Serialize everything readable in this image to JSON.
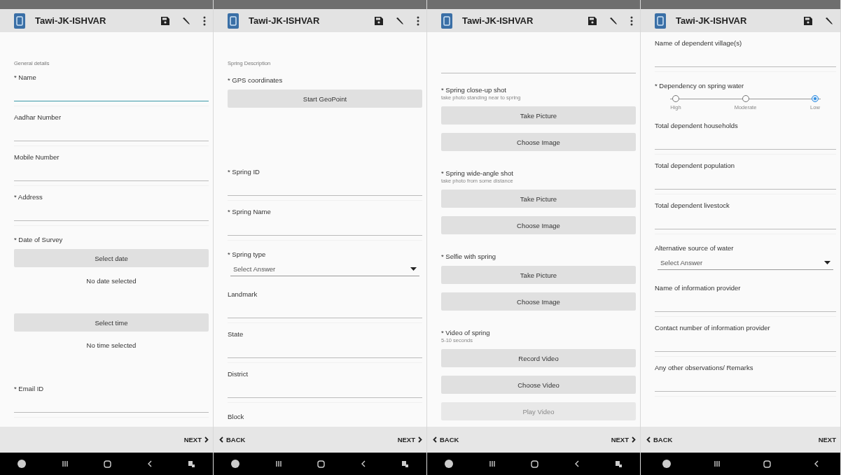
{
  "screens": [
    {
      "title": "Tawi-JK-ISHVAR",
      "menu": true,
      "nav_extra": true,
      "items": [
        {
          "kind": "section",
          "text": "General details"
        },
        {
          "kind": "field",
          "label": "* Name",
          "focused": true
        },
        {
          "kind": "field",
          "label": "Aadhar Number",
          "focused": false
        },
        {
          "kind": "field",
          "label": "Mobile Number",
          "focused": false
        },
        {
          "kind": "field",
          "label": "* Address",
          "focused": false
        },
        {
          "kind": "label",
          "text": "* Date of Survey"
        },
        {
          "kind": "button",
          "text": "Select date",
          "disabled": false
        },
        {
          "kind": "status",
          "text": "No date selected"
        },
        {
          "kind": "button",
          "text": "Select time",
          "disabled": false
        },
        {
          "kind": "status",
          "text": "No time selected"
        },
        {
          "kind": "field",
          "label": "* Email ID",
          "focused": false
        }
      ],
      "footer": {
        "next": "NEXT",
        "next_arrow": true
      }
    },
    {
      "title": "Tawi-JK-ISHVAR",
      "menu": true,
      "nav_extra": true,
      "items": [
        {
          "kind": "section",
          "text": "Spring Description"
        },
        {
          "kind": "label",
          "text": "* GPS coordinates"
        },
        {
          "kind": "button",
          "text": "Start GeoPoint",
          "disabled": false
        },
        {
          "kind": "spacer"
        },
        {
          "kind": "field",
          "label": "* Spring ID",
          "focused": false
        },
        {
          "kind": "field",
          "label": "* Spring Name",
          "focused": false
        },
        {
          "kind": "label",
          "text": "* Spring type"
        },
        {
          "kind": "select",
          "placeholder": "Select Answer"
        },
        {
          "kind": "field",
          "label": "Landmark",
          "focused": false
        },
        {
          "kind": "field",
          "label": "State",
          "focused": false
        },
        {
          "kind": "field",
          "label": "District",
          "focused": false
        },
        {
          "kind": "label",
          "text": "Block"
        }
      ],
      "footer": {
        "back": "BACK",
        "next": "NEXT",
        "next_arrow": true
      }
    },
    {
      "title": "Tawi-JK-ISHVAR",
      "menu": true,
      "nav_extra": true,
      "items": [
        {
          "kind": "line"
        },
        {
          "kind": "label",
          "text": "* Spring close-up shot",
          "hint": "take photo standing near to spring"
        },
        {
          "kind": "button",
          "text": "Take Picture",
          "disabled": false
        },
        {
          "kind": "button",
          "text": "Choose Image",
          "disabled": false
        },
        {
          "kind": "label",
          "text": "* Spring wide-angle shot",
          "hint": "take photo from some distance"
        },
        {
          "kind": "button",
          "text": "Take Picture",
          "disabled": false
        },
        {
          "kind": "button",
          "text": "Choose Image",
          "disabled": false
        },
        {
          "kind": "label",
          "text": "* Selfie with spring"
        },
        {
          "kind": "button",
          "text": "Take Picture",
          "disabled": false
        },
        {
          "kind": "button",
          "text": "Choose Image",
          "disabled": false
        },
        {
          "kind": "label",
          "text": "* Video of spring",
          "hint": "5-10 seconds"
        },
        {
          "kind": "button",
          "text": "Record Video",
          "disabled": false
        },
        {
          "kind": "button",
          "text": "Choose Video",
          "disabled": false
        },
        {
          "kind": "button",
          "text": "Play Video",
          "disabled": true
        }
      ],
      "footer": {
        "back": "BACK",
        "next": "NEXT",
        "next_arrow": true
      }
    },
    {
      "title": "Tawi-JK-ISHVAR",
      "menu": false,
      "nav_extra": false,
      "items": [
        {
          "kind": "field",
          "label": "Name of dependent village(s)",
          "focused": false
        },
        {
          "kind": "label",
          "text": "* Dependency on spring water"
        },
        {
          "kind": "radio",
          "options": [
            {
              "text": "High",
              "selected": false
            },
            {
              "text": "Moderate",
              "selected": false
            },
            {
              "text": "Low",
              "selected": true
            }
          ]
        },
        {
          "kind": "field",
          "label": "Total dependent households",
          "focused": false
        },
        {
          "kind": "field",
          "label": "Total dependent population",
          "focused": false
        },
        {
          "kind": "field",
          "label": "Total dependent livestock",
          "focused": false
        },
        {
          "kind": "label",
          "text": "Alternative source of water"
        },
        {
          "kind": "select",
          "placeholder": "Select Answer"
        },
        {
          "kind": "field",
          "label": "Name of information provider",
          "focused": false
        },
        {
          "kind": "field",
          "label": "Contact number of information provider",
          "focused": false
        },
        {
          "kind": "field",
          "label": "Any other observations/ Remarks",
          "focused": false
        }
      ],
      "footer": {
        "back": "BACK",
        "next": "NEXT",
        "next_arrow": false
      }
    }
  ]
}
